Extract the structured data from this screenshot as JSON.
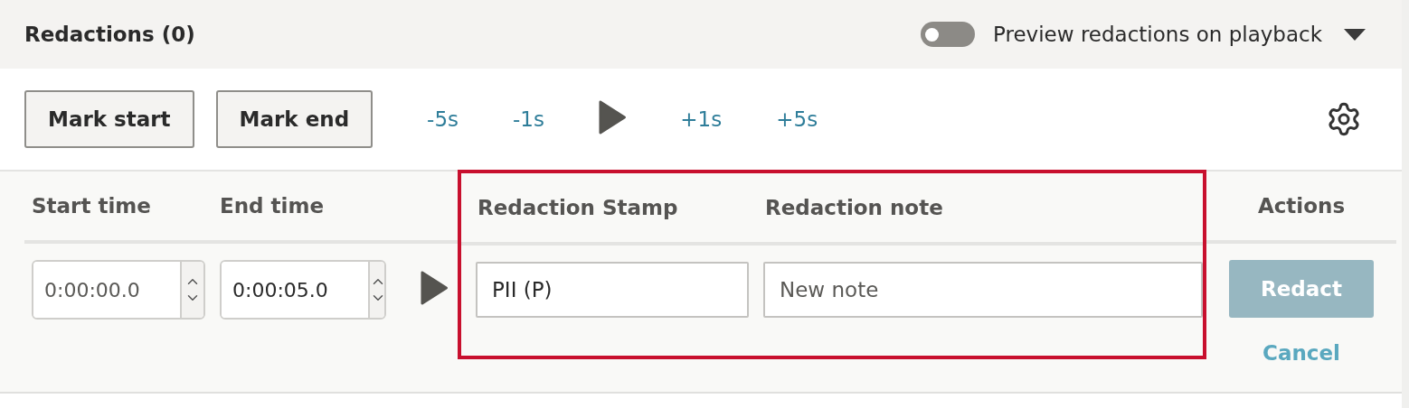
{
  "header": {
    "title": "Redactions (0)",
    "preview_toggle": {
      "label": "Preview redactions on playback",
      "on": false
    }
  },
  "toolbar": {
    "buttons": [
      "Mark start",
      "Mark end"
    ],
    "seek_links": [
      "-5s",
      "-1s",
      "+1s",
      "+5s"
    ]
  },
  "table": {
    "columns": [
      {
        "kind": "time",
        "heading": "Start time",
        "placeholder": "0:00:00.0",
        "highlighted": false
      },
      {
        "kind": "time",
        "heading": "End time",
        "value": "0:00:05.0",
        "highlighted": false
      },
      {
        "kind": "play",
        "highlighted": false
      },
      {
        "kind": "text",
        "heading": "Redaction Stamp",
        "value": "PII (P)",
        "highlighted": true
      },
      {
        "kind": "text",
        "heading": "Redaction note",
        "placeholder": "New note",
        "highlighted": true
      },
      {
        "kind": "actions",
        "heading": "Actions",
        "primary": {
          "label": "Redact",
          "disabled": true
        },
        "secondary": "Cancel",
        "highlighted": false
      }
    ]
  }
}
